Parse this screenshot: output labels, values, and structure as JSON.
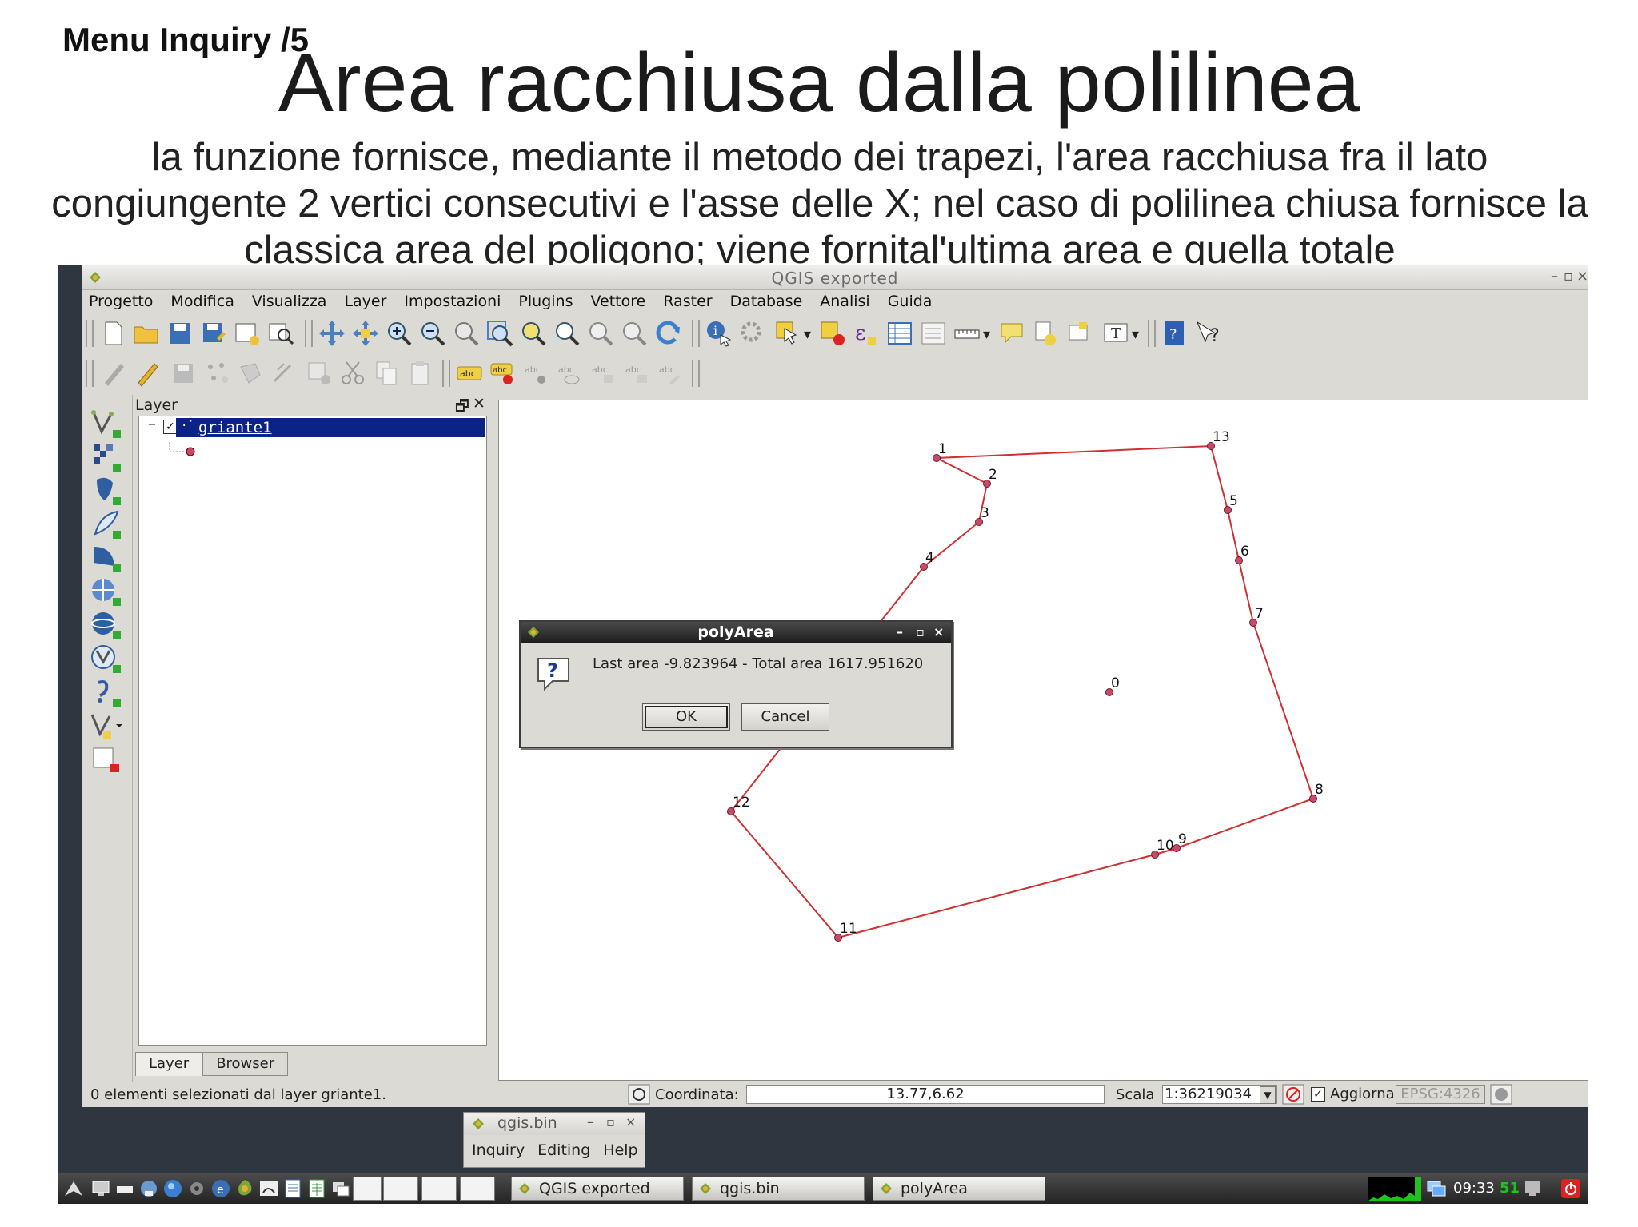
{
  "slide": {
    "subtitle": "Menu Inquiry /5",
    "title": "Area racchiusa dalla polilinea",
    "description": "la funzione fornisce, mediante il metodo dei trapezi, l'area racchiusa fra il lato congiungente 2 vertici consecutivi e l'asse delle X; nel caso di polilinea chiusa fornisce la classica area del poligono; viene fornital'ultima area e quella totale"
  },
  "window": {
    "title": "QGIS exported"
  },
  "menubar": [
    "Progetto",
    "Modifica",
    "Visualizza",
    "Layer",
    "Impostazioni",
    "Plugins",
    "Vettore",
    "Raster",
    "Database",
    "Analisi",
    "Guida"
  ],
  "layer_panel": {
    "title": "Layer",
    "layer_name": "griante1",
    "tabs": [
      "Layer",
      "Browser"
    ]
  },
  "map": {
    "vertices": [
      {
        "label": "1"
      },
      {
        "label": "2"
      },
      {
        "label": "3"
      },
      {
        "label": "4"
      },
      {
        "label": "13"
      },
      {
        "label": "5"
      },
      {
        "label": "6"
      },
      {
        "label": "7"
      },
      {
        "label": "0"
      },
      {
        "label": "8"
      },
      {
        "label": "9"
      },
      {
        "label": "10"
      },
      {
        "label": "11"
      },
      {
        "label": "12"
      }
    ],
    "line_color": "#d03030",
    "point_color": "#c84a6a"
  },
  "dialog": {
    "title": "polyArea",
    "message": "Last area -9.823964 - Total area 1617.951620",
    "ok_label": "OK",
    "cancel_label": "Cancel",
    "icon": "question-icon"
  },
  "statusbar": {
    "message": "0 elementi selezionati dal layer griante1.",
    "coord_label": "Coordinata:",
    "coord_value": "13.77,6.62",
    "scale_label": "Scala",
    "scale_value": "1:36219034",
    "render_label": "Aggiorna",
    "crs": "EPSG:4326"
  },
  "mini_panel": {
    "title": "qgis.bin",
    "menu": [
      "Inquiry",
      "Editing",
      "Help"
    ]
  },
  "taskbar": {
    "windows": [
      "QGIS exported",
      "qgis.bin",
      "polyArea"
    ],
    "clock": "09:33",
    "clock_seconds": "51"
  }
}
